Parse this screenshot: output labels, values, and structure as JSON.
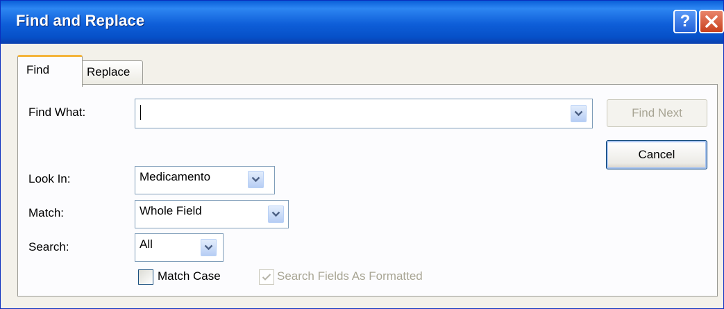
{
  "window": {
    "title": "Find and Replace",
    "help_symbol": "?"
  },
  "tabs": [
    {
      "label": "Find",
      "selected": true
    },
    {
      "label": "Replace",
      "selected": false
    }
  ],
  "find_what": {
    "label": "Find What:",
    "value": ""
  },
  "look_in": {
    "label": "Look In:",
    "value": "Medicamento"
  },
  "match": {
    "label": "Match:",
    "value": "Whole Field"
  },
  "search": {
    "label": "Search:",
    "value": "All"
  },
  "buttons": {
    "find_next": "Find Next",
    "cancel": "Cancel"
  },
  "options": {
    "match_case": {
      "label": "Match Case",
      "checked": false
    },
    "search_fields_as_formatted": {
      "label": "Search Fields As Formatted",
      "checked": true,
      "enabled": false
    }
  },
  "colors": {
    "titlebar": "#0a5fd9",
    "tab_highlight": "#f4b43a",
    "dropdown_arrow": "#4d6185",
    "disabled_text": "#a8a594"
  },
  "icons": {
    "help": "help-icon",
    "close": "close-icon",
    "dropdown": "chevron-down-icon",
    "check": "checkmark-icon"
  }
}
